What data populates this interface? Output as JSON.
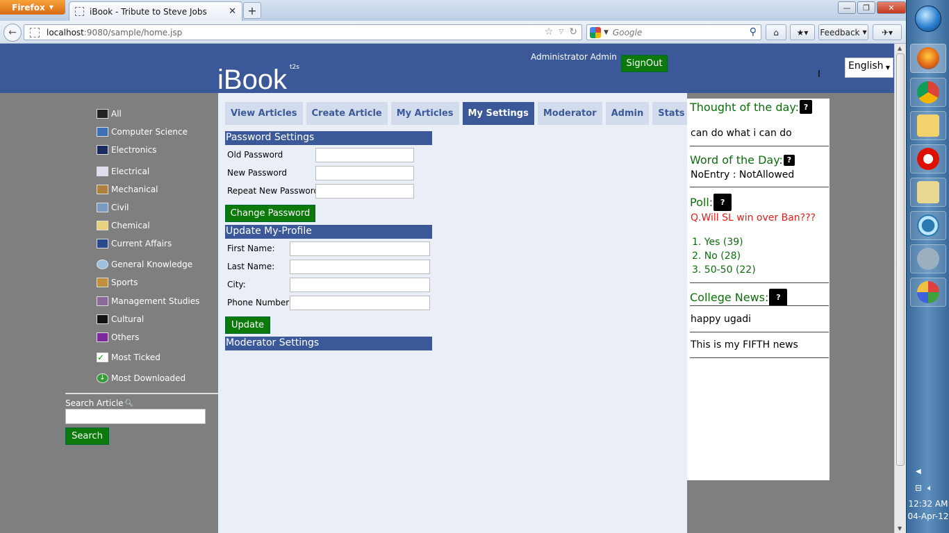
{
  "browser": {
    "menu_button": "Firefox",
    "tab_title": "iBook - Tribute to Steve Jobs",
    "new_tab": "+",
    "url_host": "localhost",
    "url_path": ":9080/sample/home.jsp",
    "search_placeholder": "Google",
    "feedback_label": "Feedback"
  },
  "taskbar": {
    "time": "12:32 AM",
    "date": "04-Apr-12"
  },
  "header": {
    "logo": "iBook",
    "logo_sup": "t2s",
    "user": "Administrator Admin",
    "signout": "SignOut",
    "language": "English"
  },
  "sidebar": {
    "categories": [
      "All",
      "Computer Science",
      "Electronics",
      "Electrical",
      "Mechanical",
      "Civil",
      "Chemical",
      "Current Affairs",
      "General Knowledge",
      "Sports",
      "Management Studies",
      "Cultural",
      "Others",
      "Most Ticked",
      "Most Downloaded"
    ],
    "search_label": "Search Article",
    "search_button": "Search"
  },
  "tabs": [
    "View Articles",
    "Create Article",
    "My Articles",
    "My Settings",
    "Moderator",
    "Admin",
    "Stats"
  ],
  "active_tab": "My Settings",
  "password_settings": {
    "title": "Password Settings",
    "old": "Old Password",
    "new": "New Password",
    "repeat": "Repeat New Password",
    "button": "Change Password"
  },
  "profile": {
    "title": "Update My-Profile",
    "first": "First Name:",
    "last": "Last Name:",
    "city": "City:",
    "phone": "Phone Number:",
    "button": "Update"
  },
  "moderator_settings": {
    "title": "Moderator Settings"
  },
  "right_panel": {
    "thought_title": "Thought of the day:",
    "thought": "can do what i can do",
    "word_title": "Word of the Day:",
    "word": "NoEntry : NotAllowed",
    "poll_title": "Poll:",
    "poll_question": "Q.Will SL win over Ban???",
    "poll_options": [
      "1. Yes (39)",
      "2. No (28)",
      "3. 50-50 (22)"
    ],
    "news_title": "College News:",
    "news": [
      "happy ugadi",
      "This is my FIFTH news"
    ]
  },
  "colors": {
    "brand_blue": "#3b5998",
    "button_green": "#0b7a0b",
    "poll_red": "#e0201a",
    "heading_green": "#0b6e0b"
  }
}
